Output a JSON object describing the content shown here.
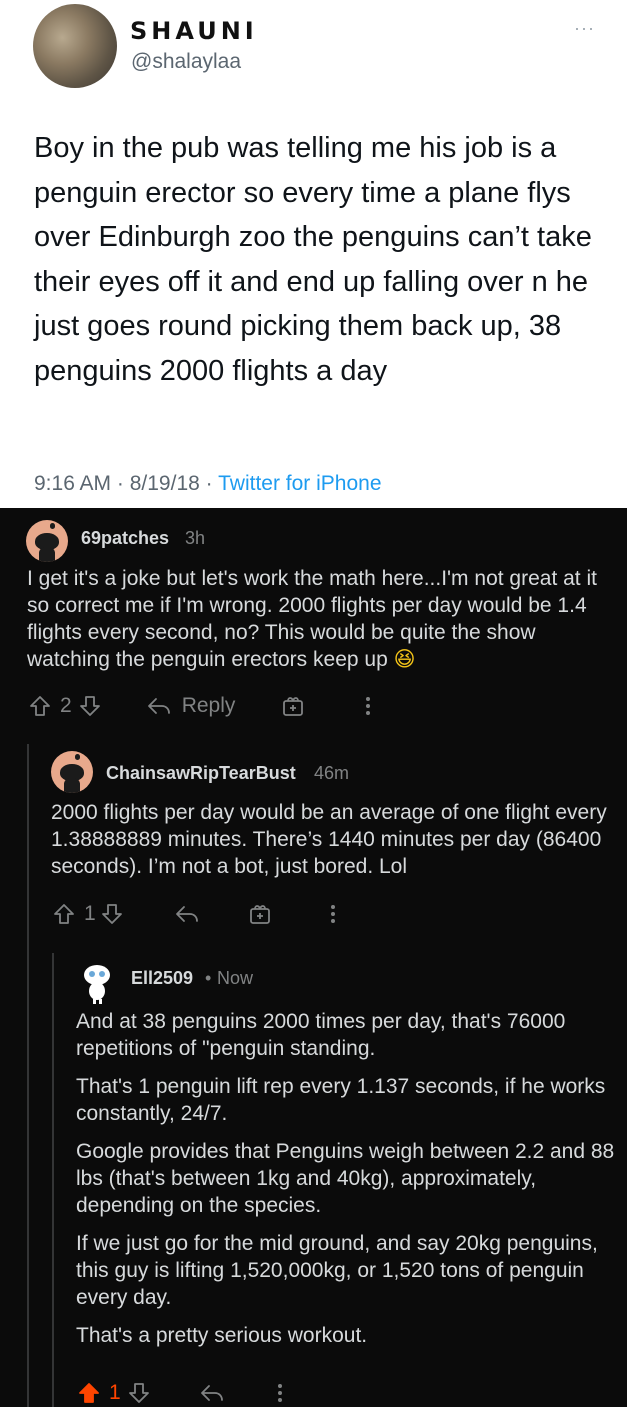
{
  "tweet": {
    "display_name": "SHAUNI",
    "handle": "@shalaylaa",
    "more": "···",
    "text": "Boy in the pub was telling me his job is a penguin erector so every time a plane flys over Edinburgh zoo the penguins can’t take their eyes off it and end up falling over n he just goes round picking them back up, 38 penguins 2000 flights a day",
    "time": "9:16 AM",
    "sep1": " · ",
    "date": "8/19/18",
    "sep2": " · ",
    "source": "Twitter for iPhone"
  },
  "comments": [
    {
      "username": "69patches",
      "age": "3h",
      "text": "I get it's a joke but let's work the math here...I'm not great at it so correct me if I'm wrong. 2000 flights per day would be 1.4 flights every second, no? This would be quite the show watching the penguin erectors keep up",
      "emoji": "😆",
      "score": "2",
      "reply_label": "Reply"
    },
    {
      "username": "ChainsawRipTearBust",
      "age": "46m",
      "text": "2000 flights per day would be an average of one flight every 1.38888889 minutes. There’s 1440 minutes per day (86400 seconds). I’m not a bot, just bored. Lol",
      "score": "1"
    },
    {
      "username": "Ell2509",
      "age_sep": "•",
      "age": "Now",
      "paragraphs": [
        "And at 38 penguins 2000 times per day, that's 76000 repetitions of \"penguin standing.",
        "That's 1 penguin lift rep every 1.137 seconds, if he works constantly, 24/7.",
        "Google provides that Penguins weigh between 2.2 and 88 lbs (that's between 1kg and 40kg), approximately, depending on the species.",
        "If we just go for the mid ground, and say 20kg penguins, this guy is lifting 1,520,000kg, or 1,520 tons of penguin every day.",
        "That's a pretty serious workout."
      ],
      "score": "1",
      "upvoted_color": "#ff4500"
    }
  ],
  "colors": {
    "tweet_bg": "#ffffff",
    "thread_bg": "#0b0b0b",
    "link": "#1d9bf0",
    "upvote": "#ff4500",
    "muted": "#818384"
  }
}
